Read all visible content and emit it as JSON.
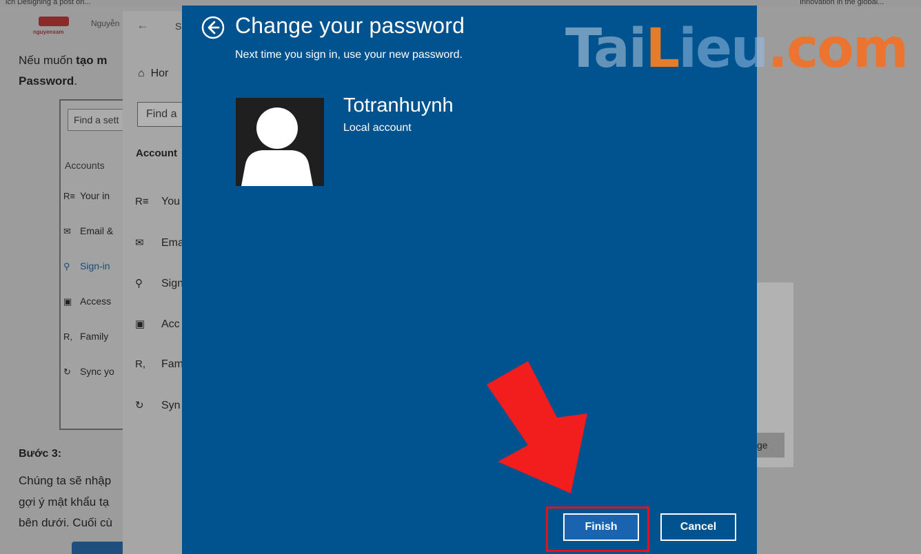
{
  "browser": {
    "tab_left": "ich Designing a post on...",
    "tab_right": "Innovation in the global..."
  },
  "article": {
    "logo_text": "nguyenxam",
    "author": "Nguyễn",
    "intro_line1_prefix": "Nếu muốn ",
    "intro_line1_bold": "tạo m",
    "intro_line2_bold": "Password",
    "intro_line2_suffix": ".",
    "step_heading": "Bước 3:",
    "body_line1": "Chúng ta sẽ nhập",
    "body_line2": "gợi ý mật khẩu tạ",
    "body_line3": "bên dưới. Cuối cù",
    "right_button_fragment": "ge"
  },
  "inner_settings": {
    "search_placeholder": "Find a sett",
    "heading": "Accounts",
    "items": [
      {
        "icon": "person-info-icon",
        "glyph": "R≡",
        "label": "Your in"
      },
      {
        "icon": "mail-icon",
        "glyph": "✉",
        "label": "Email &"
      },
      {
        "icon": "key-icon",
        "glyph": "⚲",
        "label": "Sign-in"
      },
      {
        "icon": "briefcase-icon",
        "glyph": "▣",
        "label": "Access"
      },
      {
        "icon": "family-icon",
        "glyph": "R,",
        "label": "Family"
      },
      {
        "icon": "sync-icon",
        "glyph": "↻",
        "label": "Sync yo"
      }
    ]
  },
  "settings": {
    "back_glyph": "←",
    "title_fragment": "S",
    "home_label": "Hor",
    "search_placeholder": "Find a",
    "heading": "Account",
    "items": [
      {
        "icon": "person-info-icon",
        "glyph": "R≡",
        "label": "You"
      },
      {
        "icon": "mail-icon",
        "glyph": "✉",
        "label": "Ema"
      },
      {
        "icon": "key-icon",
        "glyph": "⚲",
        "label": "Sign"
      },
      {
        "icon": "briefcase-icon",
        "glyph": "▣",
        "label": "Acc"
      },
      {
        "icon": "family-icon",
        "glyph": "R,",
        "label": "Fam"
      },
      {
        "icon": "sync-icon",
        "glyph": "↻",
        "label": "Syn"
      }
    ]
  },
  "dialog": {
    "title": "Change your password",
    "subtitle": "Next time you sign in, use your new password.",
    "username": "Totranhuynh",
    "account_type": "Local account",
    "finish_label": "Finish",
    "cancel_label": "Cancel",
    "accent_color": "#00538f",
    "highlight_color": "#e4121c"
  },
  "watermark": {
    "part1": "T",
    "part2": "ai",
    "part3": "L",
    "part4": "ieu",
    "part5": ".com"
  }
}
